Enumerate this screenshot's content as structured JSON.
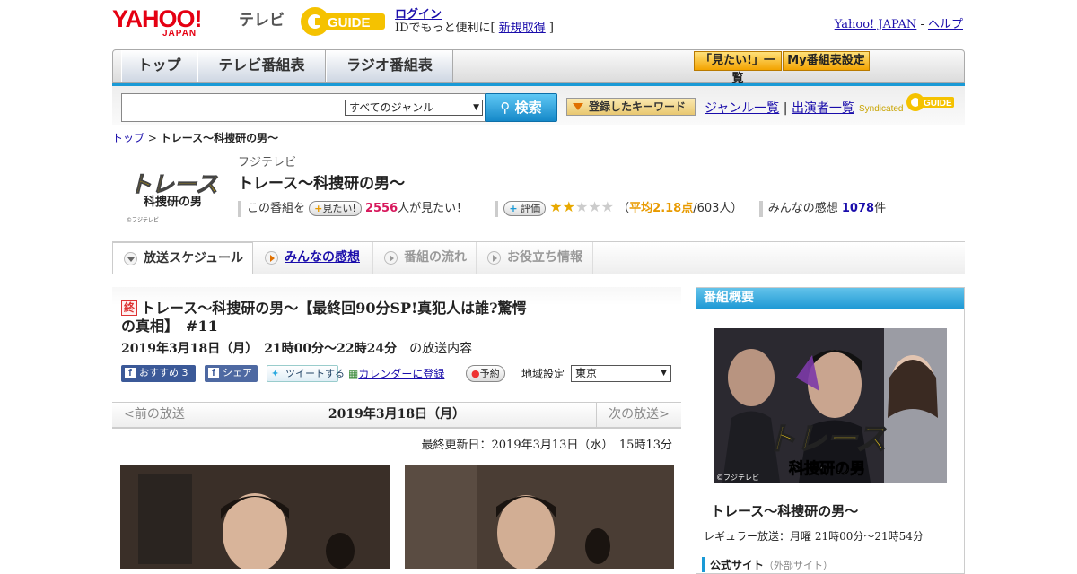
{
  "header": {
    "logo_text": "YAHOO!",
    "logo_sub": "JAPAN",
    "service_name": "テレビ",
    "gguide_text": "GUIDE",
    "login_label": "ログイン",
    "login_sub_prefix": "IDでもっと便利に[ ",
    "signup_label": "新規取得",
    "login_sub_suffix": " ]",
    "yahoo_japan_link": "Yahoo! JAPAN",
    "link_sep": " - ",
    "help_link": "ヘルプ"
  },
  "nav": {
    "tabs": [
      {
        "label": "トップ"
      },
      {
        "label": "テレビ番組表"
      },
      {
        "label": "ラジオ番組表"
      }
    ],
    "mitai_list": "「見たい!」一覧",
    "my_schedule": "My番組表設定"
  },
  "search": {
    "input_value": "",
    "genre_selected": "すべてのジャンル",
    "search_button": "検索",
    "keyword_button": "登録したキーワード",
    "genre_list": "ジャンル一覧",
    "cast_list": "出演者一覧",
    "syndicated": "Syndicated"
  },
  "breadcrumb": {
    "top": "トップ",
    "sep": " > ",
    "current": "トレース～科捜研の男～"
  },
  "program": {
    "thumb_title_1": "トレース",
    "thumb_title_2": "科捜研の男",
    "thumb_copy": "©フジテレビ",
    "station": "フジテレビ",
    "title": "トレース～科捜研の男～",
    "mitai_prefix": "この番組を",
    "mitai_button": "見たい!",
    "mitai_count": "2556",
    "mitai_suffix": "人が見たい！",
    "rate_button": "評価",
    "rating_fraction": 0.436,
    "rating_open": "（",
    "rating_avg": "平均2.18点",
    "rating_count": "/603人）",
    "impressions_prefix": "みんなの感想",
    "impressions_count": "1078",
    "impressions_suffix": "件"
  },
  "tabs": [
    {
      "label": "放送スケジュール",
      "state": "active"
    },
    {
      "label": "みんなの感想",
      "state": "link"
    },
    {
      "label": "番組の流れ",
      "state": "disabled"
    },
    {
      "label": "お役立ち情報",
      "state": "disabled"
    }
  ],
  "episode": {
    "end_mark": "終",
    "title": "トレース～科捜研の男～【最終回90分SP!真犯人は誰?驚愕の真相】",
    "number": "#11",
    "date": "2019年3月18日（月）　21時00分～22時24分",
    "date_suffix": "の放送内容",
    "recommend": "おすすめ",
    "recommend_count": "3",
    "share": "シェア",
    "tweet": "ツイートする",
    "calendar": "カレンダーに登録",
    "reserve": "予約",
    "region_label": "地域設定",
    "region_selected": "東京"
  },
  "pager": {
    "prev": "<前の放送",
    "current": "2019年3月18日（月）",
    "next": "次の放送>"
  },
  "updated": "最終更新日：2019年3月13日（水）　15時13分",
  "side": {
    "heading": "番組概要",
    "poster_title_1": "トレース",
    "poster_title_2": "科捜研の男",
    "poster_copy": "©フジテレビ",
    "title": "トレース～科捜研の男～",
    "regular": "レギュラー放送：月曜 21時00分～21時54分",
    "official_site": "公式サイト",
    "external": "（外部サイト）"
  },
  "colors": {
    "accent_blue": "#1a9ad6",
    "yahoo_red": "#e50012",
    "highlight_pink": "#d7185c",
    "rating_orange": "#e89a00"
  }
}
